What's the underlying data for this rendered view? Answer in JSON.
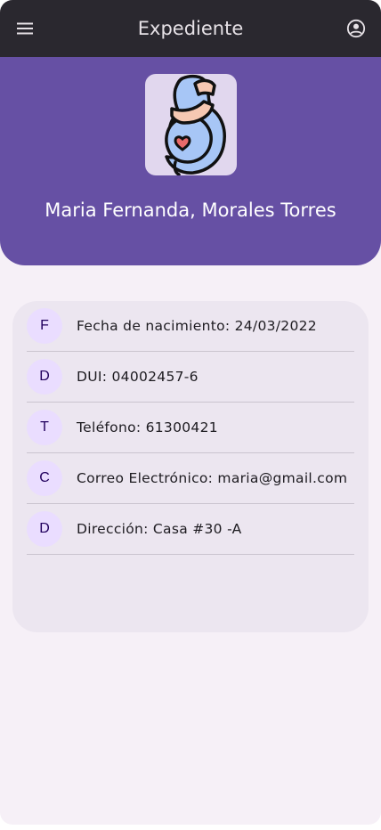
{
  "appbar": {
    "title": "Expediente",
    "menu_icon": "menu-icon",
    "account_icon": "account-circle-icon"
  },
  "header": {
    "avatar_icon": "pregnant-woman-icon",
    "patient_name": "Maria Fernanda, Morales Torres"
  },
  "details": {
    "items": [
      {
        "initial": "F",
        "text": "Fecha de nacimiento: 24/03/2022"
      },
      {
        "initial": "D",
        "text": "DUI: 04002457-6"
      },
      {
        "initial": "T",
        "text": "Teléfono: 61300421"
      },
      {
        "initial": "C",
        "text": "Correo Electrónico: maria@gmail.com"
      },
      {
        "initial": "D",
        "text": "Dirección: Casa #30 -A"
      }
    ]
  },
  "colors": {
    "appbar_bg": "#2a282f",
    "header_bg": "#6650a4",
    "page_bg": "#f6f0f7",
    "card_bg": "#ece6f0",
    "chip_bg": "#eaddff"
  }
}
